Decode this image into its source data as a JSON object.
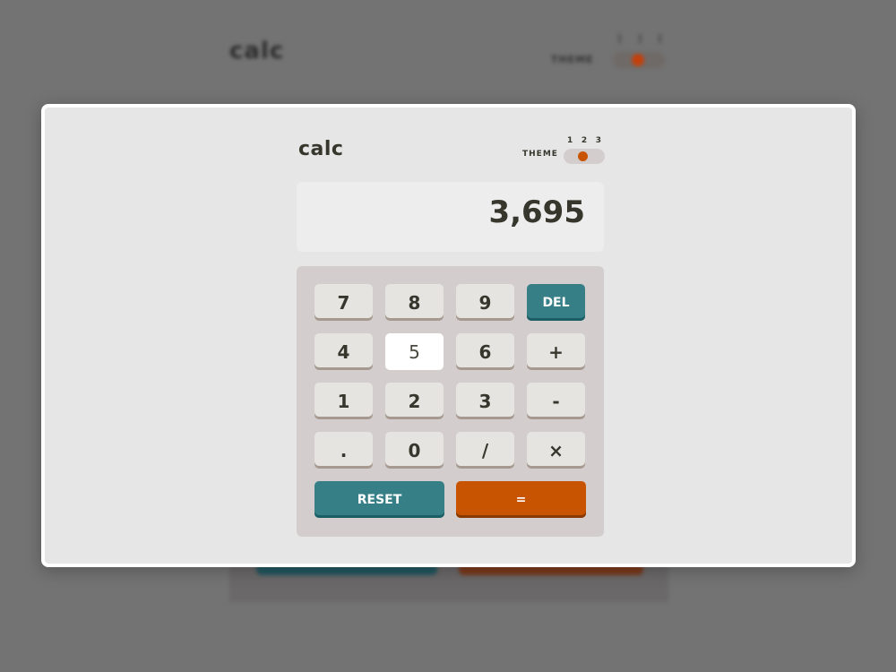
{
  "background": {
    "logo": "calc",
    "theme_label": "THEME"
  },
  "app": {
    "logo": "calc",
    "theme": {
      "label": "THEME",
      "options": [
        "1",
        "2",
        "3"
      ],
      "selected": 2
    },
    "display": "3,695",
    "keys": {
      "k7": "7",
      "k8": "8",
      "k9": "9",
      "del": "DEL",
      "k4": "4",
      "k5": "5",
      "k6": "6",
      "plus": "+",
      "k1": "1",
      "k2": "2",
      "k3": "3",
      "minus": "-",
      "dot": ".",
      "k0": "0",
      "divide": "/",
      "multiply": "×",
      "reset": "RESET",
      "equals": "="
    },
    "active_key": "5"
  },
  "colors": {
    "accent_orange": "#c85402",
    "accent_teal": "#377f86",
    "text": "#36362c"
  }
}
